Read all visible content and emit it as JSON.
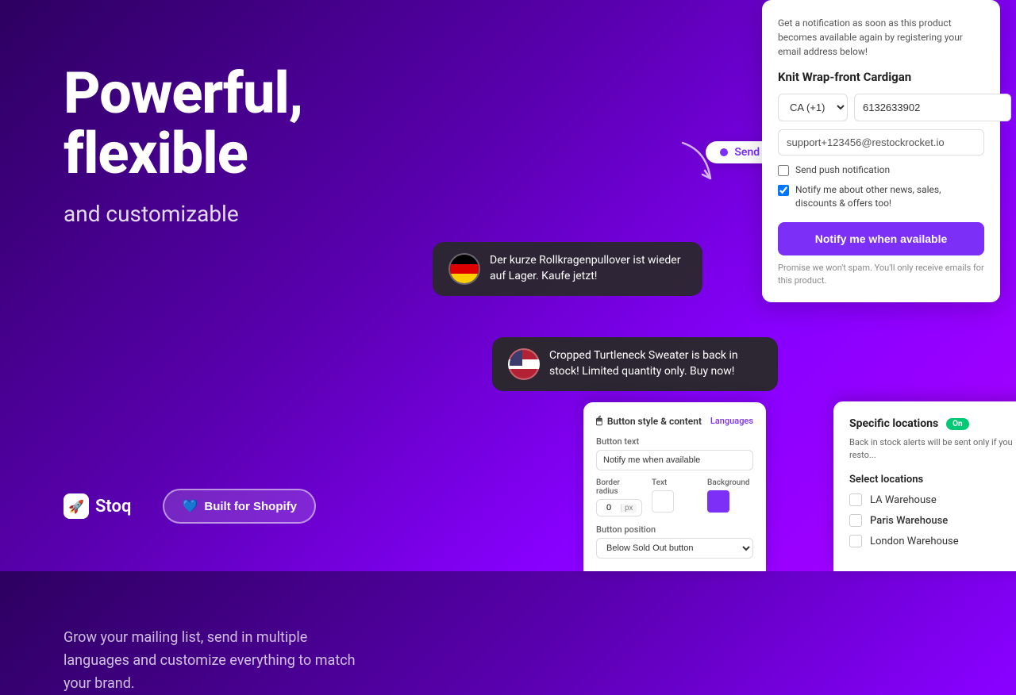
{
  "headline": {
    "line1": "Powerful,",
    "line2": "flexible",
    "line3": "and customizable"
  },
  "description": "Grow your mailing list, send in multiple languages and customize everything to match your brand.",
  "brand": {
    "logo_text": "Stoq",
    "shopify_btn": "Built for Shopify"
  },
  "send_notification_label": "Send notification",
  "arrow": "↗",
  "german_bubble": {
    "text": "Der kurze Rollkragenpullover ist wieder auf Lager. Kaufe jetzt!"
  },
  "english_bubble": {
    "text": "Cropped Turtleneck Sweater is back in stock! Limited quantity only. Buy now!"
  },
  "notification_form": {
    "intro": "Get a notification as soon as this product becomes available again by registering your email address below!",
    "product_name": "Knit Wrap-front Cardigan",
    "country_code": "CA (+1)",
    "phone": "6132633902",
    "email": "support+123456@restockrocket.io",
    "push_label": "Send push notification",
    "news_label": "Notify me about other news, sales, discounts & offers too!",
    "notify_btn": "Notify me when available",
    "spam_note": "Promise we won't spam. You'll only receive emails for this product."
  },
  "button_style_card": {
    "title": "Button style & content",
    "lang_link": "Languages",
    "button_text_label": "Button text",
    "button_text_value": "Notify me when available",
    "border_radius_label": "Border radius",
    "border_radius_value": "0",
    "border_radius_unit": "px",
    "text_label": "Text",
    "background_label": "Background",
    "position_label": "Button position",
    "position_value": "Below Sold Out button"
  },
  "locations_card": {
    "title": "Specific locations",
    "badge": "On",
    "description": "Back in stock alerts will be sent only if you resto...",
    "select_label": "Select locations",
    "locations": [
      {
        "name": "LA Warehouse",
        "checked": false
      },
      {
        "name": "Paris Warehouse",
        "checked": false
      },
      {
        "name": "London Warehouse",
        "checked": false
      }
    ]
  }
}
